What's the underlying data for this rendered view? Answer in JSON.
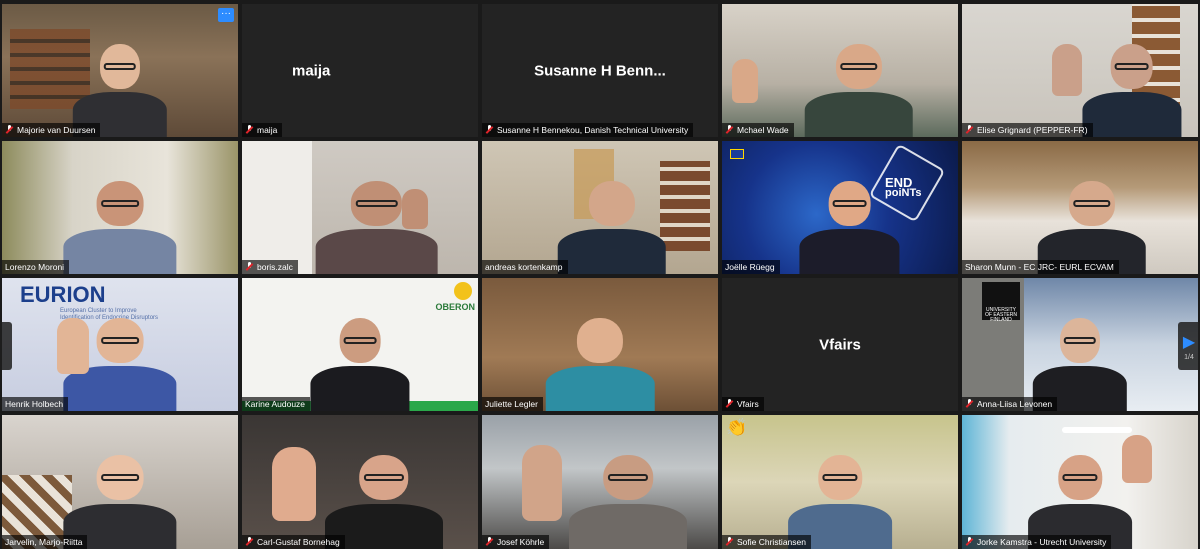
{
  "meeting": {
    "more_button": "···",
    "page_indicator": "1/4",
    "reaction_emoji": "👏"
  },
  "participants": [
    {
      "name": "Majorie van Duursen"
    },
    {
      "name": "maija",
      "display": "maija"
    },
    {
      "name": "Susanne H Bennekou, Danish Technical University",
      "display": "Susanne H Benn..."
    },
    {
      "name": "Mchael Wade"
    },
    {
      "name": "Elise Grignard (PEPPER-FR)"
    },
    {
      "name": "Lorenzo Moroni"
    },
    {
      "name": "boris.zalc"
    },
    {
      "name": "andreas kortenkamp"
    },
    {
      "name": "Joëlle Rüegg"
    },
    {
      "name": "Sharon Munn - EC JRC- EURL ECVAM"
    },
    {
      "name": "Henrik Holbech",
      "logo": "EURION",
      "logo_sub": "European Cluster to Improve Identification of Endocrine Disruptors"
    },
    {
      "name": "Karine Audouze",
      "logo": "OBERON"
    },
    {
      "name": "Juliette Legler"
    },
    {
      "name": "Vfairs",
      "display": "Vfairs"
    },
    {
      "name": "Anna-Liisa Levonen",
      "logo": "UNIVERSITY OF EASTERN FINLAND"
    },
    {
      "name": "Jarvelin, Marjo-Riitta"
    },
    {
      "name": "Carl-Gustaf Bornehag"
    },
    {
      "name": "Josef Köhrle"
    },
    {
      "name": "Sofie Christiansen"
    },
    {
      "name": "Jorke Kamstra - Utrecht University"
    }
  ],
  "endpoints_logo": {
    "line1": "END",
    "line2": "poiNTs"
  }
}
